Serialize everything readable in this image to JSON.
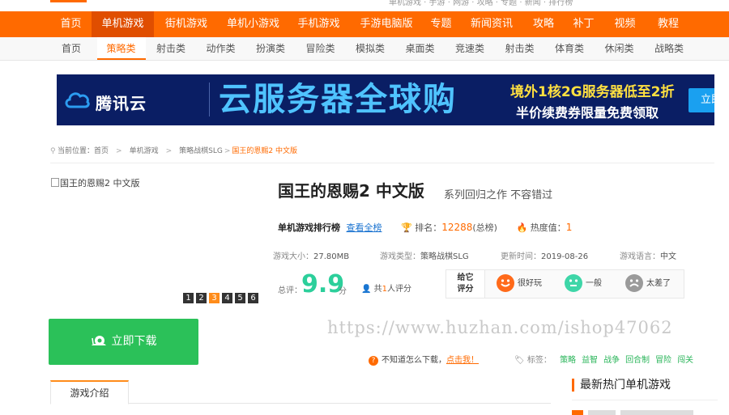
{
  "top_links": "单机游戏 · 手游 · 网游 · 攻略 · 专题 · 新闻 · 排行榜",
  "main_nav": [
    "首页",
    "单机游戏",
    "街机游戏",
    "单机小游戏",
    "手机游戏",
    "手游电脑版",
    "专题",
    "新闻资讯",
    "攻略",
    "补丁",
    "视频",
    "教程"
  ],
  "main_nav_active": "单机游戏",
  "sub_nav": [
    "首页",
    "策略类",
    "射击类",
    "动作类",
    "扮演类",
    "冒险类",
    "模拟类",
    "桌面类",
    "竞速类",
    "射击类",
    "体育类",
    "休闲类",
    "战略类"
  ],
  "sub_nav_active": "策略类",
  "banner": {
    "brand": "腾讯云",
    "headline": "云服务器全球购",
    "sub1": "境外1核2G服务器低至2折",
    "sub2": "半价续费券限量免费领取",
    "cta": "立即抢购"
  },
  "breadcrumb": {
    "prefix": "当前位置：",
    "items": [
      "首页",
      "单机游戏",
      "策略战棋SLG"
    ],
    "current": "国王的恩赐2 中文版"
  },
  "game": {
    "image_alt": "国王的恩赐2 中文版",
    "pager": [
      "1",
      "2",
      "3",
      "4",
      "5",
      "6"
    ],
    "pager_active": "3",
    "title": "国王的恩赐2 中文版",
    "slogan": "系列回归之作 不容错过"
  },
  "rank": {
    "label": "单机游戏排行榜",
    "link": "查看全榜",
    "rank_label": "排名：",
    "rank_value": "12288",
    "rank_suffix": "(总榜)",
    "heat_label": "热度值：",
    "heat_value": "1"
  },
  "info": {
    "size_label": "游戏大小：",
    "size_value": "27.80MB",
    "type_label": "游戏类型：",
    "type_value": "策略战棋SLG",
    "date_label": "更新时间：",
    "date_value": "2019-08-26",
    "lang_label": "游戏语言：",
    "lang_value": "中文"
  },
  "score": {
    "label": "总评：",
    "value": "9.9",
    "unit": "分",
    "people_prefix": "共",
    "people_count": "1",
    "people_suffix": "人评分"
  },
  "rating": {
    "give_line1": "给它",
    "give_line2": "评分",
    "options": [
      {
        "label": "很好玩",
        "color": "#ff6a1a"
      },
      {
        "label": "一般",
        "color": "#3ed6a8"
      },
      {
        "label": "太差了",
        "color": "#9a9a9a"
      }
    ]
  },
  "download": {
    "label": "立即下载",
    "color": "#2bc159"
  },
  "watermark": "https://www.huzhan.com/ishop47062",
  "help": {
    "text": "不知道怎么下载，",
    "link": "点击我！"
  },
  "tags": {
    "label": "标签：",
    "items": [
      "策略",
      "益智",
      "战争",
      "回合制",
      "冒险",
      "闯关"
    ]
  },
  "intro_tab": "游戏介绍",
  "hot_title": "最新热门单机游戏",
  "colors": {
    "brand_orange": "#ff6a00",
    "green": "#2bc159",
    "score_green": "#2ccf9b"
  }
}
